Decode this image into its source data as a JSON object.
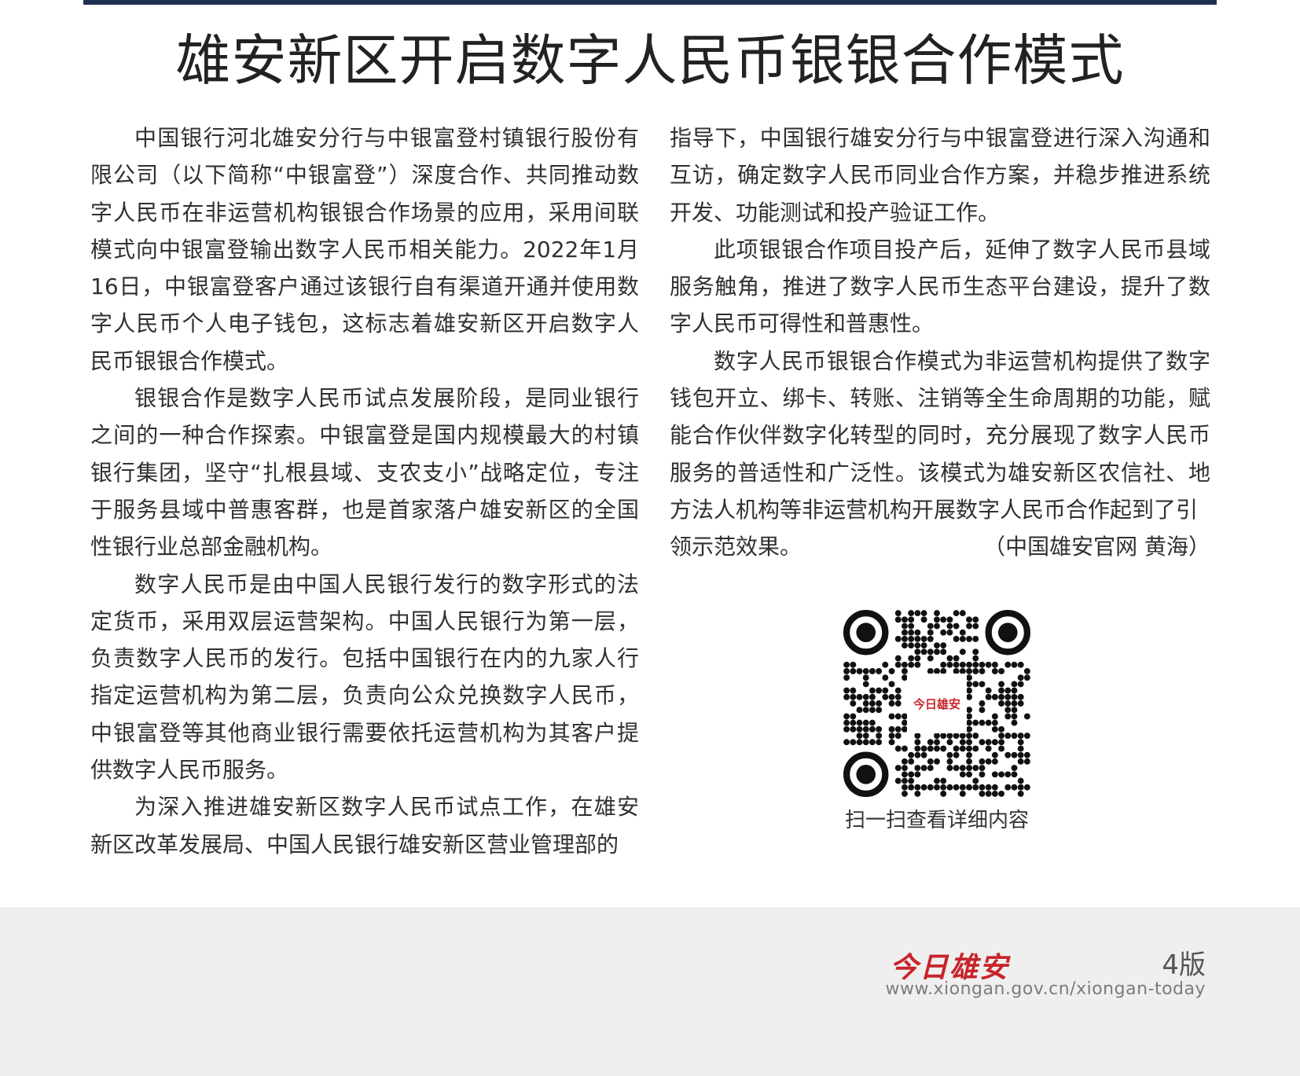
{
  "article": {
    "title": "雄安新区开启数字人民币银银合作模式",
    "left_paragraphs": [
      "中国银行河北雄安分行与中银富登村镇银行股份有限公司（以下简称“中银富登”）深度合作、共同推动数字人民币在非运营机构银银合作场景的应用，采用间联模式向中银富登输出数字人民币相关能力。2022年1月16日，中银富登客户通过该银行自有渠道开通并使用数字人民币个人电子钱包，这标志着雄安新区开启数字人民币银银合作模式。",
      "银银合作是数字人民币试点发展阶段，是同业银行之间的一种合作探索。中银富登是国内规模最大的村镇银行集团，坚守“扎根县域、支农支小”战略定位，专注于服务县域中普惠客群，也是首家落户雄安新区的全国性银行业总部金融机构。",
      "数字人民币是由中国人民银行发行的数字形式的法定货币，采用双层运营架构。中国人民银行为第一层，负责数字人民币的发行。包括中国银行在内的九家人行指定运营机构为第二层，负责向公众兑换数字人民币，中银富登等其他商业银行需要依托运营机构为其客户提供数字人民币服务。",
      "为深入推进雄安新区数字人民币试点工作，在雄安新区改革发展局、中国人民银行雄安新区营业管理部的"
    ],
    "right_continuation": "指导下，中国银行雄安分行与中银富登进行深入沟通和互访，确定数字人民币同业合作方案，并稳步推进系统开发、功能测试和投产验证工作。",
    "right_paragraphs": [
      "此项银银合作项目投产后，延伸了数字人民币县域服务触角，推进了数字人民币生态平台建设，提升了数字人民币可得性和普惠性。",
      "数字人民币银银合作模式为非运营机构提供了数字钱包开立、绑卡、转账、注销等全生命周期的功能，赋能合作伙伴数字化转型的同时，充分展现了数字人民币服务的普适性和广泛性。该模式为雄安新区农信社、地方法人机构等非运营机构开展数字人民币合作起到了引"
    ],
    "last_line_text": "领示范效果。",
    "byline": "（中国雄安官网 黄海）"
  },
  "qr": {
    "logo_text": "今日雄安",
    "caption": "扫一扫查看详细内容"
  },
  "footer": {
    "brand": "今日雄安",
    "edition": "4版",
    "url": "www.xiongan.gov.cn/xiongan-today"
  },
  "colors": {
    "top_rule": "#1f2f52",
    "brand_red": "#c8242b",
    "footer_bg": "#efefef"
  }
}
